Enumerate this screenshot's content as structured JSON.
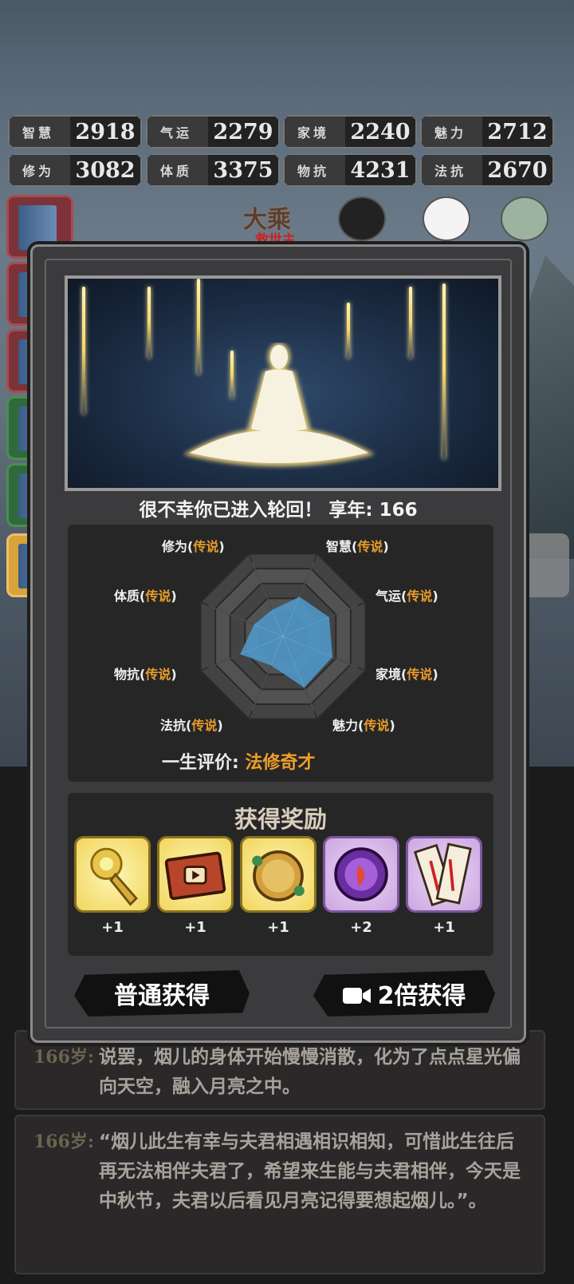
{
  "stats": [
    {
      "label": "智慧",
      "value": "2918"
    },
    {
      "label": "气运",
      "value": "2279"
    },
    {
      "label": "家境",
      "value": "2240"
    },
    {
      "label": "魅力",
      "value": "2712"
    },
    {
      "label": "修为",
      "value": "3082"
    },
    {
      "label": "体质",
      "value": "3375"
    },
    {
      "label": "物抗",
      "value": "4231"
    },
    {
      "label": "法抗",
      "value": "2670"
    }
  ],
  "header": {
    "realm": "大乘",
    "realm_sub": "救世主"
  },
  "modal": {
    "message": "很不幸你已进入轮回！ 享年: 166",
    "radar": {
      "attributes": [
        {
          "name": "修为",
          "quality": "传说"
        },
        {
          "name": "智慧",
          "quality": "传说"
        },
        {
          "name": "气运",
          "quality": "传说"
        },
        {
          "name": "家境",
          "quality": "传说"
        },
        {
          "name": "魅力",
          "quality": "传说"
        },
        {
          "name": "法抗",
          "quality": "传说"
        },
        {
          "name": "物抗",
          "quality": "传说"
        },
        {
          "name": "体质",
          "quality": "传说"
        }
      ],
      "values": [
        0.32,
        0.48,
        0.56,
        0.6,
        0.62,
        0.35,
        0.52,
        0.35
      ]
    },
    "evaluation_label": "一生评价:",
    "evaluation_value": "法修奇才",
    "reward_title": "获得奖励",
    "rewards": [
      {
        "icon": "golden-key-icon",
        "count": "+1",
        "tier": "gold"
      },
      {
        "icon": "video-scroll-icon",
        "count": "+1",
        "tier": "gold"
      },
      {
        "icon": "jade-plate-icon",
        "count": "+1",
        "tier": "gold"
      },
      {
        "icon": "purple-orb-icon",
        "count": "+2",
        "tier": "purple"
      },
      {
        "icon": "talisman-scroll-icon",
        "count": "+1",
        "tier": "purple"
      }
    ],
    "btn_normal": "普通获得",
    "btn_double": "2倍获得"
  },
  "logs": [
    {
      "age": "166岁:",
      "text": "说罢，烟儿的身体开始慢慢消散，化为了点点星光偏向天空，融入月亮之中。"
    },
    {
      "age": "166岁:",
      "text": "“烟儿此生有幸与夫君相遇相识相知，可惜此生往后再无法相伴夫君了，希望来生能与夫君相伴，今天是中秋节，夫君以后看见月亮记得要想起烟儿。”。"
    }
  ]
}
